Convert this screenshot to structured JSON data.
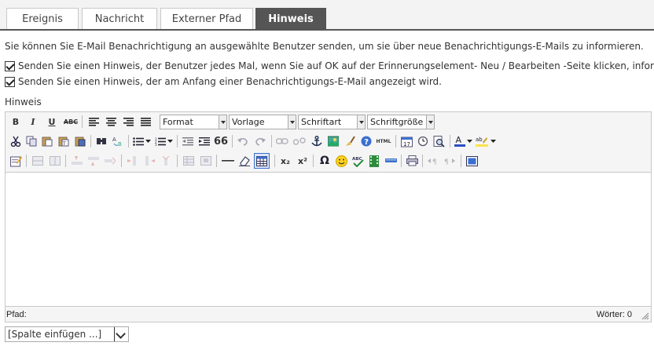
{
  "tabs": [
    "Ereignis",
    "Nachricht",
    "Externer Pfad",
    "Hinweis"
  ],
  "active_tab": "Hinweis",
  "description": "Sie können Sie E-Mail Benachrichtigung an ausgewählte Benutzer senden, um sie über neue Benachrichtigungs-E-Mails zu informieren.",
  "checkboxes": [
    {
      "label": "Senden Sie einen Hinweis, der Benutzer jedes Mal, wenn Sie auf OK auf der Erinnerungselement- Neu / Bearbeiten -Seite klicken, informiert.",
      "checked": true
    },
    {
      "label": "Senden Sie einen Hinweis, der am Anfang einer Benachrichtigungs-E-Mail angezeigt wird.",
      "checked": true
    }
  ],
  "field_label": "Hinweis",
  "editor": {
    "dropdowns": {
      "format": "Format",
      "vorlage": "Vorlage",
      "schriftart": "Schriftart",
      "schriftgroesse": "Schriftgröße"
    },
    "toolbar_text": {
      "bold": "B",
      "italic": "I",
      "underline": "U",
      "strike": "ABC",
      "quote": "66",
      "html": "HTML",
      "sub": "x₂",
      "sup": "x²",
      "omega": "Ω"
    },
    "status_path": "Pfad:",
    "status_words": "Wörter: 0"
  },
  "column_select": {
    "selected": "[Spalte einfügen ...]"
  },
  "colors": {
    "active_tab_bg": "#555555",
    "tab_bar_bg": "#f3f3f3"
  }
}
